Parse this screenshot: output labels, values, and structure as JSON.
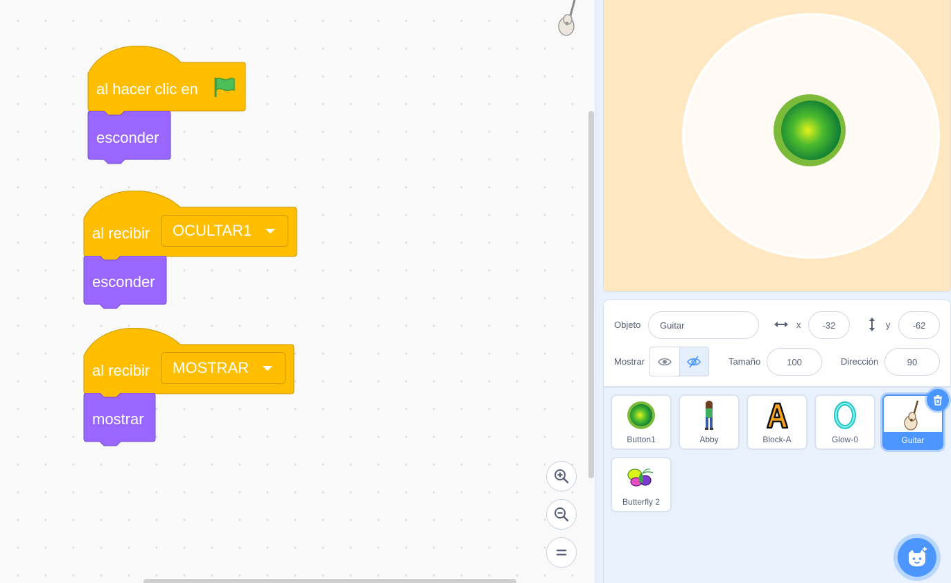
{
  "scripts": [
    {
      "hat": {
        "label": "al hacer clic en",
        "icon": "green-flag-icon"
      },
      "stack": [
        "esconder"
      ]
    },
    {
      "hat": {
        "label": "al recibir",
        "message": "OCULTAR1"
      },
      "stack": [
        "esconder"
      ]
    },
    {
      "hat": {
        "label": "al recibir",
        "message": "MOSTRAR"
      },
      "stack": [
        "mostrar"
      ]
    }
  ],
  "zoom_controls": {
    "zoom_in_icon": "zoom-in-icon",
    "zoom_out_icon": "zoom-out-icon",
    "reset_icon": "zoom-reset-icon"
  },
  "sprite_info": {
    "sprite_label": "Objeto",
    "sprite_name": "Guitar",
    "x_label": "x",
    "x_value": "-32",
    "y_label": "y",
    "y_value": "-62",
    "show_label": "Mostrar",
    "size_label": "Tamaño",
    "size_value": "100",
    "direction_label": "Dirección",
    "direction_value": "90"
  },
  "sprites": [
    {
      "name": "Button1",
      "selected": false
    },
    {
      "name": "Abby",
      "selected": false
    },
    {
      "name": "Block-A",
      "selected": false
    },
    {
      "name": "Glow-0",
      "selected": false
    },
    {
      "name": "Guitar",
      "selected": true
    },
    {
      "name": "Butterfly 2",
      "selected": false
    }
  ],
  "colors": {
    "events": "#ffbf00",
    "looks": "#9966ff",
    "accent": "#4c97ff",
    "stage_bg": "#ffe8c1"
  }
}
